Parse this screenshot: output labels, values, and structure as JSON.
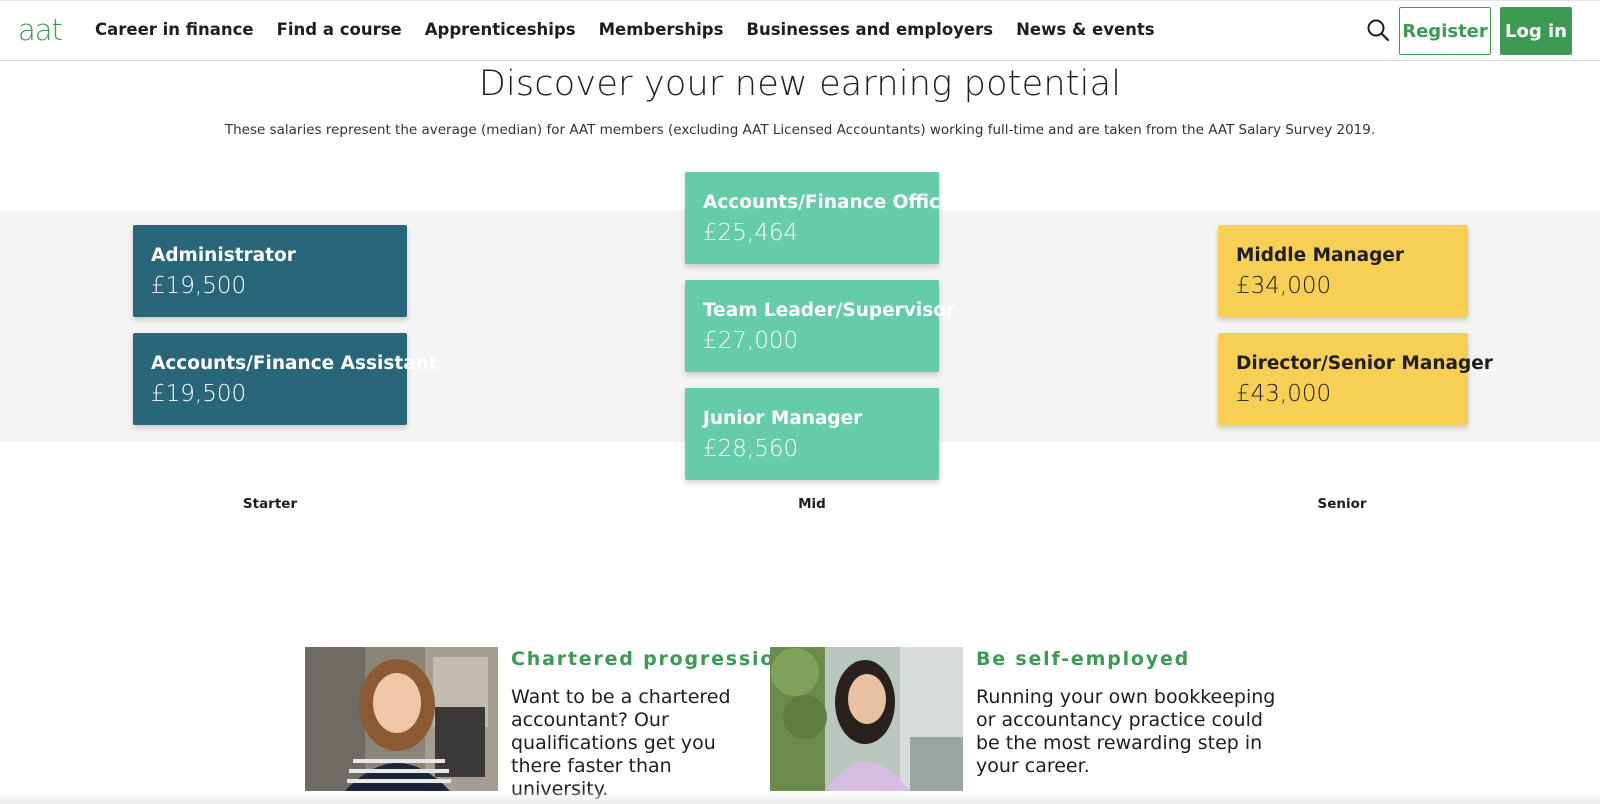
{
  "header": {
    "logo": "aat",
    "nav": [
      "Career in finance",
      "Find a course",
      "Apprenticeships",
      "Memberships",
      "Businesses and employers",
      "News & events"
    ],
    "search_icon": "search-icon",
    "register_label": "Register",
    "login_label": "Log in"
  },
  "main": {
    "title": "Discover your new earning potential",
    "subtitle": "These salaries represent the average (median) for AAT members (excluding AAT Licensed Accountants) working full-time and are taken from the AAT Salary Survey 2019.",
    "columns": [
      {
        "label": "Starter",
        "color": "#296679",
        "roles": [
          {
            "title": "Administrator",
            "salary": "£19,500"
          },
          {
            "title": "Accounts/Finance Assistant",
            "salary": "£19,500"
          }
        ]
      },
      {
        "label": "Mid",
        "color": "#66cbaa",
        "roles": [
          {
            "title": "Accounts/Finance Officer",
            "salary": "£25,464"
          },
          {
            "title": "Team Leader/Supervisor",
            "salary": "£27,000"
          },
          {
            "title": "Junior Manager",
            "salary": "£28,560"
          }
        ]
      },
      {
        "label": "Senior",
        "color": "#f6cf54",
        "roles": [
          {
            "title": "Middle Manager",
            "salary": "£34,000"
          },
          {
            "title": "Director/Senior Manager",
            "salary": "£43,000"
          }
        ]
      }
    ]
  },
  "promos": [
    {
      "title": "Chartered progression",
      "text": "Want to be a chartered accountant? Our qualifications get you there faster than university."
    },
    {
      "title": "Be self-employed",
      "text": "Running your own bookkeeping or accountancy practice could be the most rewarding step in your career."
    }
  ],
  "colors": {
    "accent": "#3c9a52",
    "starter": "#296679",
    "mid": "#66cbaa",
    "senior": "#f6cf54"
  }
}
